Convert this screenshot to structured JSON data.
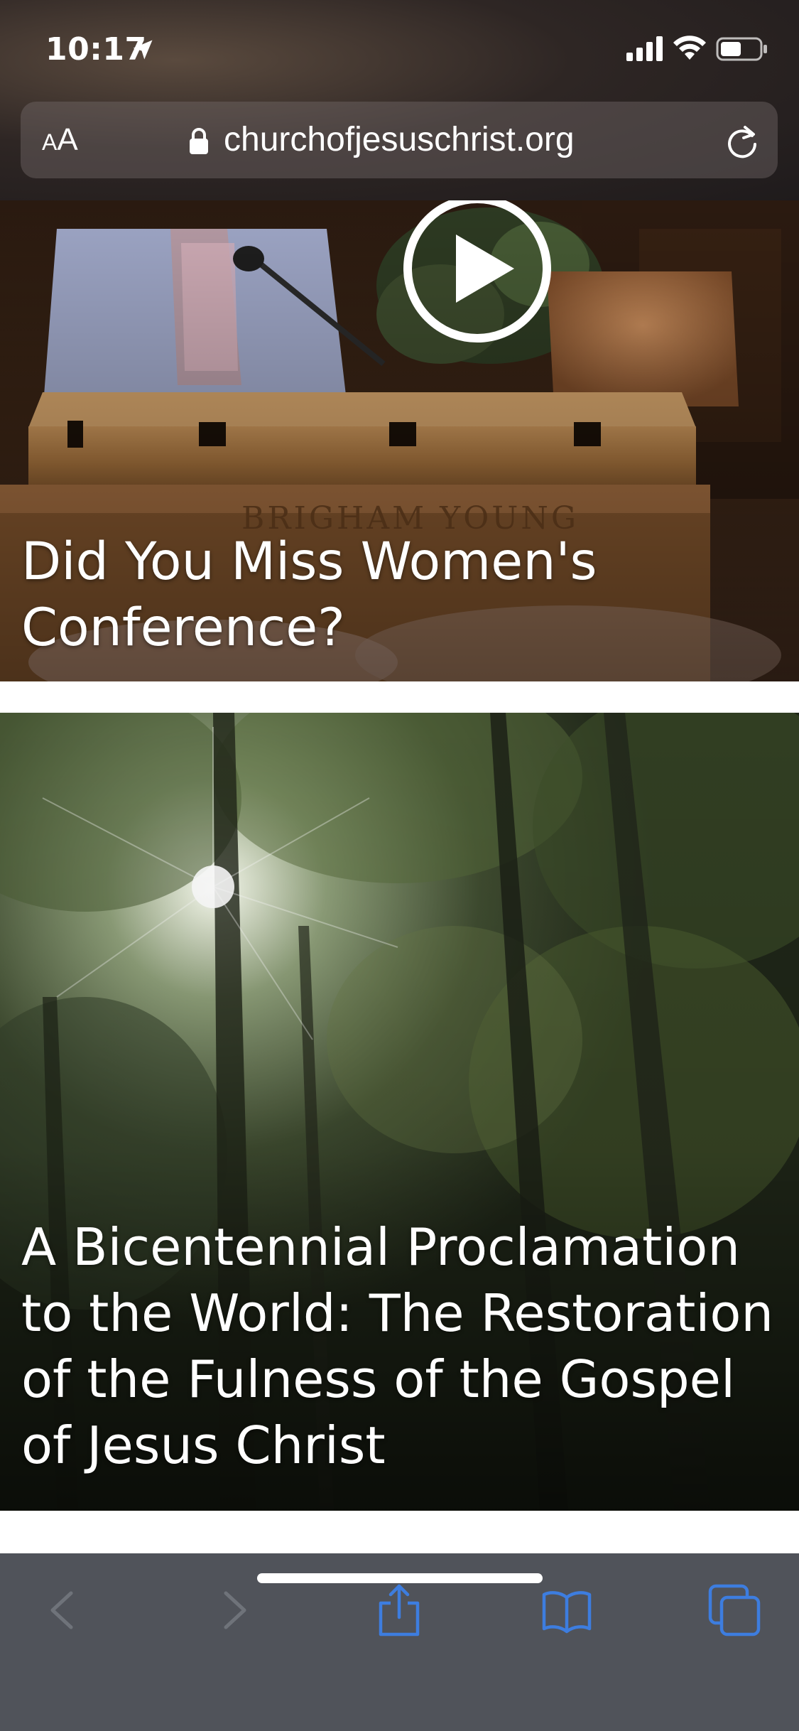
{
  "status_bar": {
    "time": "10:17"
  },
  "browser": {
    "aa_small": "A",
    "aa_big": "A",
    "url": "churchofjesuschrist.org"
  },
  "cards": [
    {
      "title": "Did You Miss Women's Conference?",
      "image_text": "BRIGHAM YOUNG"
    },
    {
      "title": "A Bicentennial Proclamation to the World: The Restoration of the Fulness of the Gospel of Jesus Christ"
    }
  ],
  "toolbar": {
    "icons": [
      "back-icon",
      "forward-icon",
      "share-icon",
      "bookmarks-icon",
      "tabs-icon"
    ]
  },
  "colors": {
    "toolbar_bg": "#50535a",
    "accent_blue": "#3d7ddf",
    "disabled_gray": "#6f737a"
  }
}
